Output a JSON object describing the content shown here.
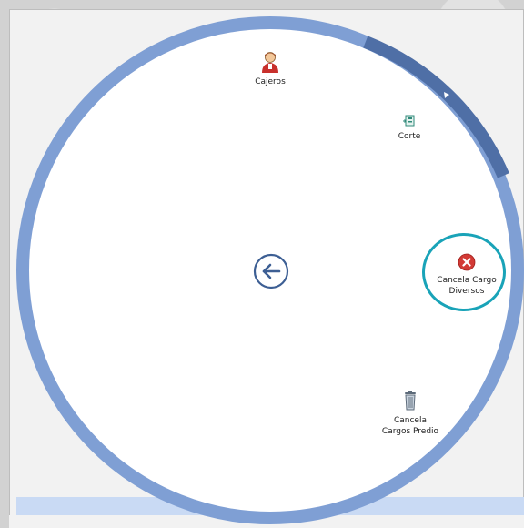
{
  "menu": {
    "items": [
      {
        "label": "Cajeros",
        "icon": "cashier-person-icon"
      },
      {
        "label": "Corte",
        "icon": "register-cut-icon"
      },
      {
        "label": "Cancela Cargo Diversos",
        "line1": "Cancela Cargo",
        "line2": "Diversos",
        "icon": "cancel-x-icon"
      },
      {
        "label": "Cancela Cargos Predio",
        "line1": "Cancela",
        "line2": "Cargos Predio",
        "icon": "trash-can-icon"
      }
    ],
    "back": {
      "icon": "back-arrow-icon"
    }
  },
  "colors": {
    "ring": "#7f9fd4",
    "ring_selected": "#4f6fa6",
    "accent_highlight": "#19a3b8",
    "back_button": "#3d5f94",
    "cancel_red": "#d23a35"
  }
}
